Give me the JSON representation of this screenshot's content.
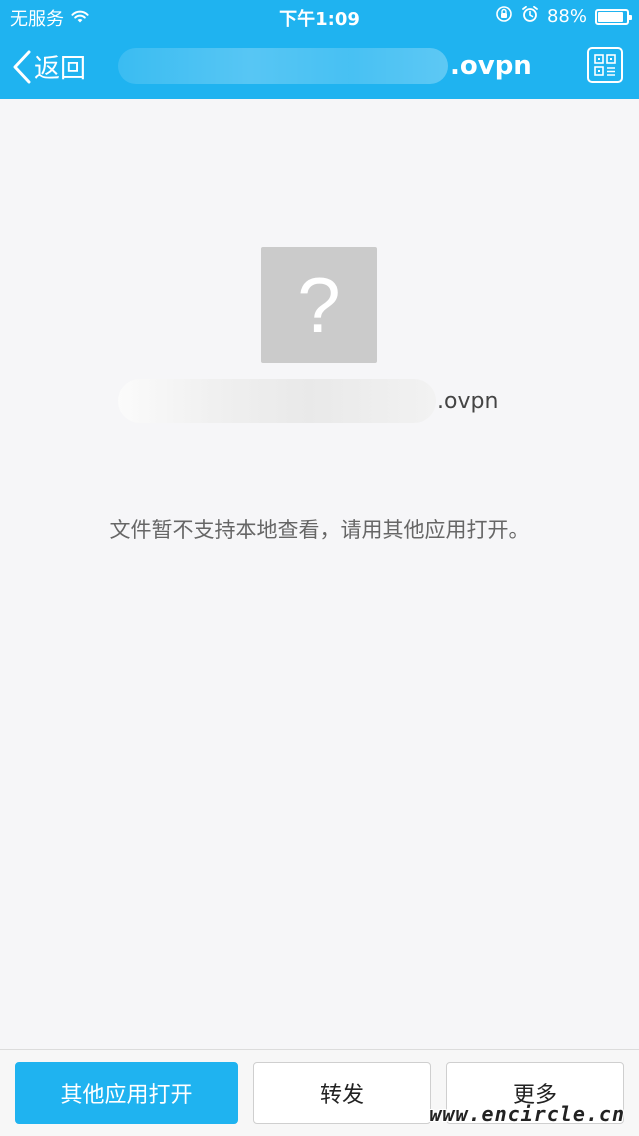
{
  "status_bar": {
    "carrier": "无服务",
    "time": "下午1:09",
    "battery_percent": "88%",
    "battery_level": 0.88,
    "icons": [
      "wifi-icon",
      "orientation-lock-icon",
      "alarm-icon",
      "battery-icon"
    ]
  },
  "nav": {
    "back_label": "返回",
    "title_suffix": ".ovpn",
    "qr_icon": "qr-code-icon"
  },
  "content": {
    "file_icon_glyph": "?",
    "file_name_suffix": ".ovpn",
    "message": "文件暂不支持本地查看，请用其他应用打开。"
  },
  "toolbar": {
    "open_with_label": "其他应用打开",
    "forward_label": "转发",
    "more_label": "更多"
  },
  "watermark": "www.encircle.cn",
  "colors": {
    "accent": "#1fb3f0",
    "background": "#f6f6f8",
    "file_icon": "#cbcbcb"
  }
}
